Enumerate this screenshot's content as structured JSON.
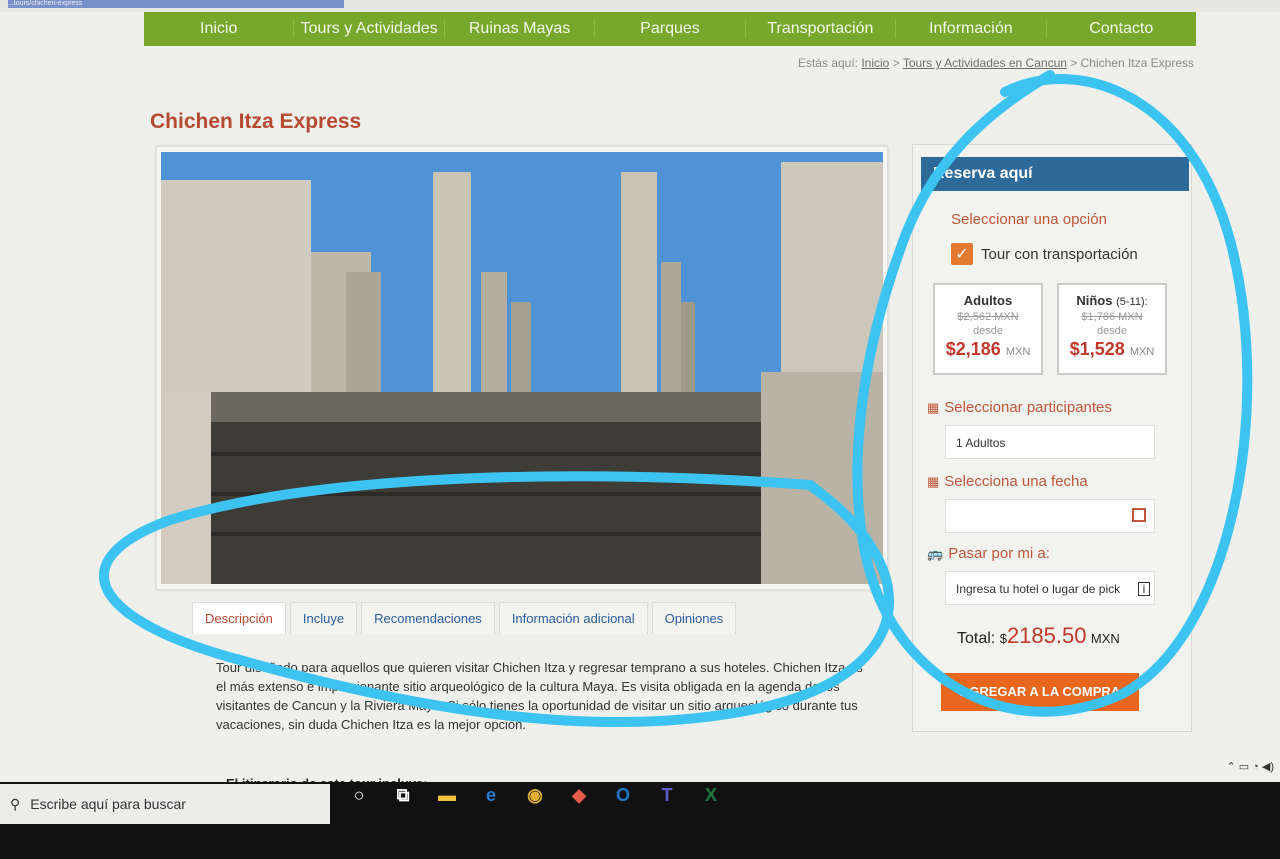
{
  "browser": {
    "url": "...tours/chichen-express"
  },
  "nav": {
    "items": [
      "Inicio",
      "Tours y Actividades",
      "Ruinas Mayas",
      "Parques",
      "Transportación",
      "Información",
      "Contacto"
    ]
  },
  "breadcrumb": {
    "prefix": "Estás aquí:",
    "links": [
      "Inicio",
      "Tours y Actividades en Cancun"
    ],
    "current": "Chichen Itza Express"
  },
  "page": {
    "title": "Chichen Itza Express"
  },
  "tabs": [
    "Descripción",
    "Incluye",
    "Recomendaciones",
    "Información adicional",
    "Opiniones"
  ],
  "description": {
    "text": "Tour diseñado para aquellos que quieren visitar Chichen Itza y regresar temprano a sus hoteles. Chichen Itza es el más extenso e impresionante sitio arqueológico de la cultura Maya. Es visita obligada en la agenda de los visitantes de Cancun y la Riviera Maya. Si sólo tienes la oportunidad de visitar un sitio arqueológico durante tus vacaciones, sin duda Chichen Itza es la mejor opción.",
    "itinerary_heading": "El itinerario de este tour incluye:"
  },
  "booking": {
    "header": "Reserva aquí",
    "select_option": "Seleccionar una opción",
    "option_label": "Tour con transportación",
    "option_checked": true,
    "adults": {
      "label": "Adultos",
      "old_price": "$2,562 MXN",
      "from": "desde",
      "price": "$2,186",
      "currency": "MXN"
    },
    "children": {
      "label": "Niños",
      "age": "(5-11):",
      "old_price": "$1,786 MXN",
      "from": "desde",
      "price": "$1,528",
      "currency": "MXN"
    },
    "participants_label": "Seleccionar participantes",
    "participants_value": "1 Adultos",
    "date_label": "Selecciona una fecha",
    "date_value": "",
    "pickup_label": "Pasar por mi a:",
    "pickup_placeholder": "Ingresa tu hotel o lugar de pick",
    "total_label": "Total:",
    "total_currency_symbol": "$",
    "total_value": "2185.50",
    "total_currency": "MXN",
    "button_label": "AGREGAR A LA COMPRA"
  },
  "taskbar": {
    "search_placeholder": "Escribe aquí para buscar"
  },
  "colors": {
    "nav": "#77a82b",
    "accent": "#c0573b",
    "header": "#2d6a9a",
    "button": "#e8661e",
    "annotation": "#3cc3f2"
  }
}
